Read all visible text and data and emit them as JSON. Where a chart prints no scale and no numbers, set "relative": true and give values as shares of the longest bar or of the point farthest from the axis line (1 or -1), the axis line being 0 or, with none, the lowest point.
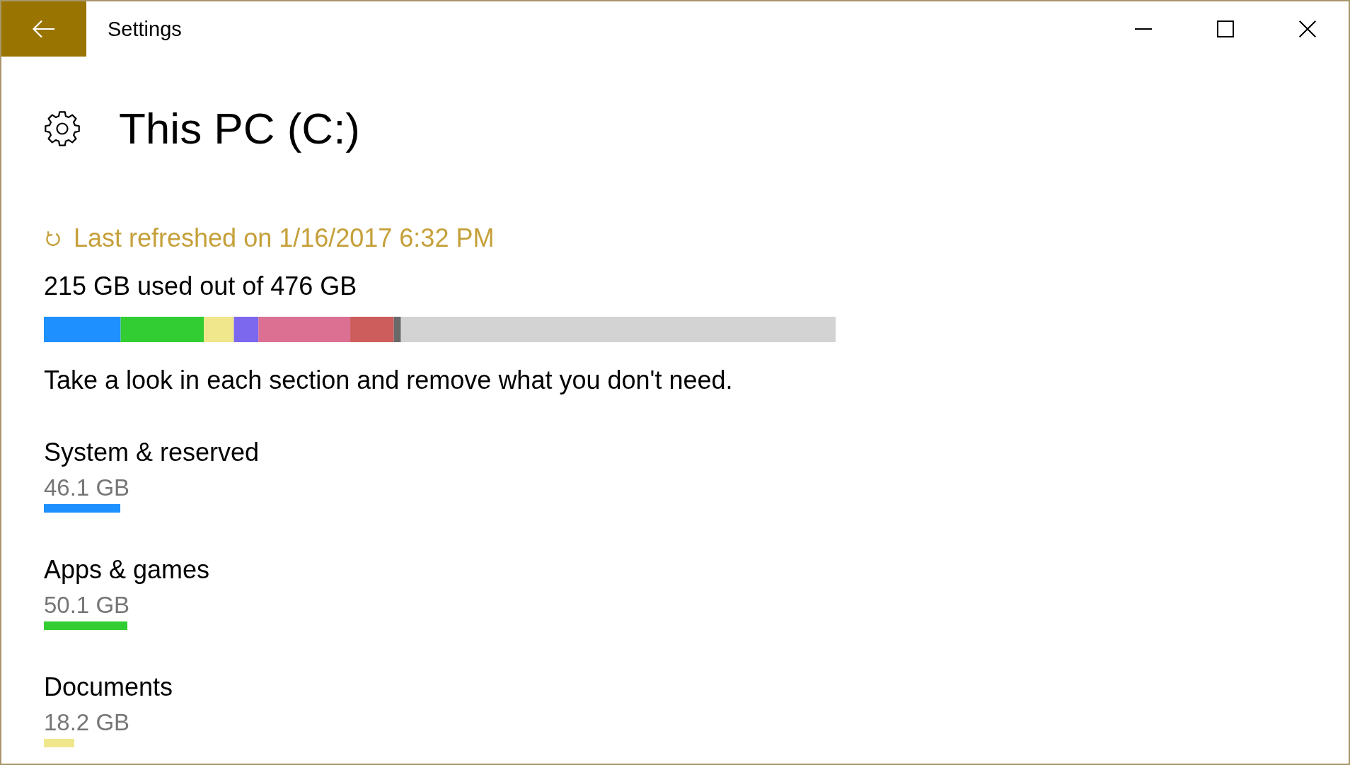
{
  "window": {
    "title": "Settings"
  },
  "header": {
    "title": "This PC (C:)"
  },
  "refresh": {
    "label": "Last refreshed on 1/16/2017 6:32 PM"
  },
  "usage_summary": "215 GB used out of 476 GB",
  "usage_bar": {
    "chart_data": {
      "type": "bar",
      "orientation": "horizontal",
      "stacked": true,
      "relative": true,
      "series": [
        {
          "color": "#1e90ff",
          "values": [
            0.097
          ]
        },
        {
          "color": "#32cd32",
          "values": [
            0.105
          ]
        },
        {
          "color": "#f0e68c",
          "values": [
            0.038
          ]
        },
        {
          "color": "#7b68ee",
          "values": [
            0.031
          ]
        },
        {
          "color": "#db7093",
          "values": [
            0.116
          ]
        },
        {
          "color": "#cd5c5c",
          "values": [
            0.055
          ]
        },
        {
          "color": "#696969",
          "values": [
            0.009
          ]
        },
        {
          "color": "#d3d3d3",
          "values": [
            0.549
          ]
        }
      ]
    }
  },
  "hint": "Take a look in each section and remove what you don't need.",
  "categories": [
    {
      "name": "System & reserved",
      "size": "46.1 GB",
      "color": "#1e90ff",
      "level": 0.0968
    },
    {
      "name": "Apps & games",
      "size": "50.1 GB",
      "color": "#32cd32",
      "level": 0.1053
    },
    {
      "name": "Documents",
      "size": "18.2 GB",
      "color": "#f0e68c",
      "level": 0.0382
    }
  ]
}
